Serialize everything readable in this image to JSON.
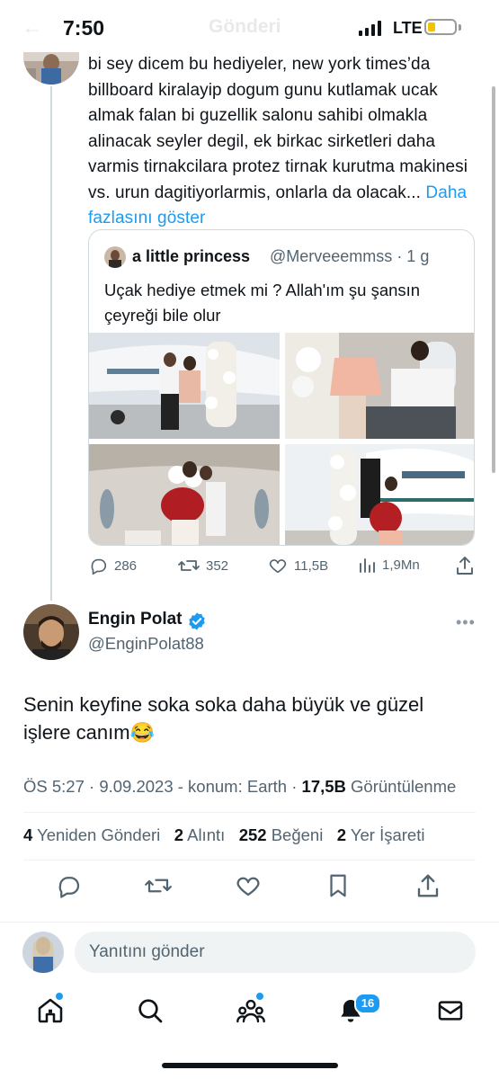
{
  "status_bar": {
    "time": "7:50",
    "network": "LTE",
    "header_ghost": "Gönderi"
  },
  "previous_tweet": {
    "text": "bi sey dicem bu hediyeler, new york times’da billboard kiralayip dogum gunu kutlamak ucak almak falan bi guzellik salonu sahibi olmakla alinacak seyler degil, ek birkac sirketleri daha varmis tirnakcilara protez tirnak kurutma makinesi vs. urun dagitiyorlarmis, onlarla da olacak...",
    "show_more": "Daha fazlasını göster",
    "quote": {
      "name": "a little princess",
      "handle": "@Merveeemmss",
      "time": "· 1 g",
      "text": "Uçak hediye etmek mi ? Allah'ım  şu şansın çeyreği bile olur"
    },
    "actions": {
      "replies": "286",
      "reposts": "352",
      "likes": "11,5B",
      "views": "1,9Mn"
    }
  },
  "main_tweet": {
    "name": "Engin Polat",
    "handle": "@EnginPolat88",
    "text": "Senin keyfine soka soka daha büyük ve güzel işlere canım😂",
    "meta": {
      "time": "ÖS 5:27 · 9.09.2023 - konum: Earth · ",
      "views_value": "17,5B",
      "views_label": " Görüntülenme"
    },
    "stats": {
      "reposts_value": "4",
      "reposts_label": " Yeniden Gönderi",
      "quotes_value": "2",
      "quotes_label": " Alıntı",
      "likes_value": "252",
      "likes_label": " Beğeni",
      "bookmarks_value": "2",
      "bookmarks_label": " Yer İşareti"
    }
  },
  "reply": {
    "placeholder": "Yanıtını gönder"
  },
  "nav": {
    "notifications_badge": "16"
  },
  "colors": {
    "accent": "#1d9bf0",
    "text": "#0f1419",
    "secondary": "#536471",
    "border": "#cfd9de"
  }
}
